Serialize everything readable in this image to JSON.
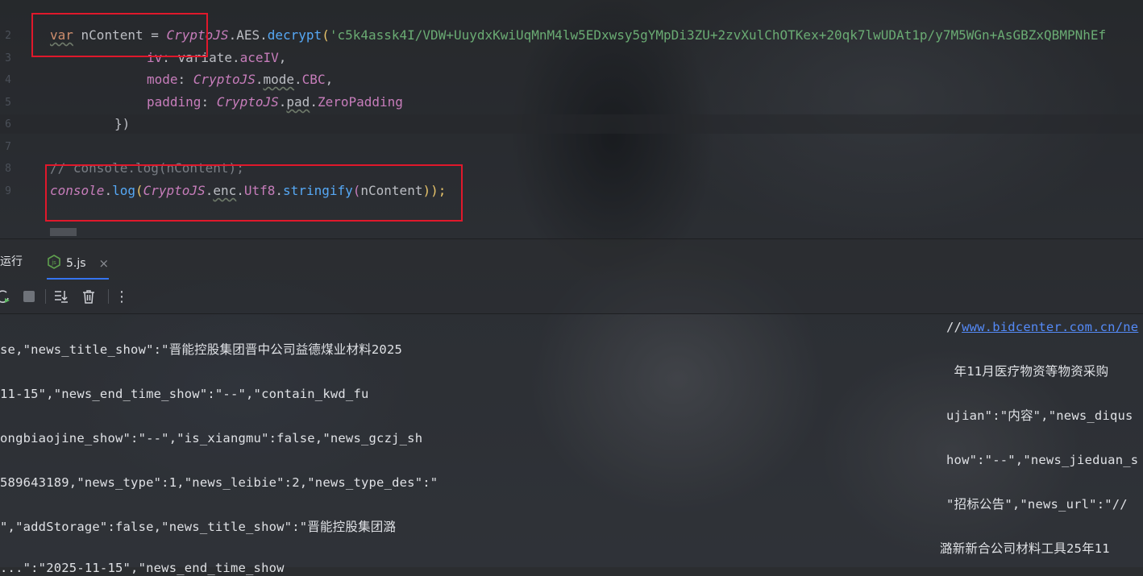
{
  "editor": {
    "line_numbers": [
      "2",
      "3",
      "4",
      "5",
      "6",
      "7",
      "8",
      "9"
    ],
    "line2": {
      "kw_var": "var",
      "ident": " nContent ",
      "eq": "= ",
      "obj": "CryptoJS",
      "dot1": ".",
      "aes": "AES",
      "dot2": ".",
      "fn": "decrypt",
      "paren": "(",
      "str": "'c5k4assk4I/VDW+UuydxKwiUqMnM4lw5EDxwsy5gYMpDi3ZU+2zvXulChOTKex+20qk7lwUDAt1p/y7M5WGn+AsGBZxQBMPNhEf"
    },
    "line3": {
      "prop": "iv",
      "colon": ": ",
      "obj": "variate",
      "dot": ".",
      "val": "aceIV",
      "comma": ","
    },
    "line4": {
      "prop": "mode",
      "colon": ": ",
      "obj": "CryptoJS",
      "dot1": ".",
      "mid": "mode",
      "dot2": ".",
      "val": "CBC",
      "comma": ","
    },
    "line5": {
      "prop": "padding",
      "colon": ": ",
      "obj": "CryptoJS",
      "dot1": ".",
      "mid": "pad",
      "dot2": ".",
      "val": "ZeroPadding"
    },
    "line6": {
      "text": "})"
    },
    "line8": {
      "comment": "// console.log(nContent);"
    },
    "line9": {
      "obj": "console",
      "dot1": ".",
      "fn": "log",
      "p1": "(",
      "obj2": "CryptoJS",
      "dot2": ".",
      "enc": "enc",
      "dot3": ".",
      "utf8": "Utf8",
      "dot4": ".",
      "fn2": "stringify",
      "p2": "(",
      "arg": "nContent",
      "close": "));"
    }
  },
  "run_panel": {
    "title": "运行",
    "tab_label": "5.js",
    "tab_close": "×",
    "more_icon": "⋮"
  },
  "console": {
    "left": [
      "se,\"news_title_show\":\"晋能控股集团晋中公司益德煤业材料2025",
      "11-15\",\"news_end_time_show\":\"--\",\"contain_kwd_fu",
      "ongbiaojine_show\":\"--\",\"is_xiangmu\":false,\"news_gczj_sh",
      "589643189,\"news_type\":1,\"news_leibie\":2,\"news_type_des\":\"",
      "\",\"addStorage\":false,\"news_title_show\":\"晋能控股集团潞",
      "...\":\"2025-11-15\",\"news_end_time_show"
    ],
    "right_prefix": "//",
    "right_link": "www.bidcenter.com.cn/ne",
    "right": [
      " 年11月医疗物资等物资采购",
      "ujian\":\"内容\",\"news_diqus",
      "how\":\"--\",\"news_jieduan_s",
      "\"招标公告\",\"news_url\":\"//",
      "潞新新合公司材料工具25年11"
    ]
  },
  "colors": {
    "highlight_box": "#e0182b",
    "keyword": "#cf8e6d",
    "string": "#6aab73",
    "function": "#56a8f5",
    "property": "#c77dbb",
    "link": "#548af7"
  }
}
